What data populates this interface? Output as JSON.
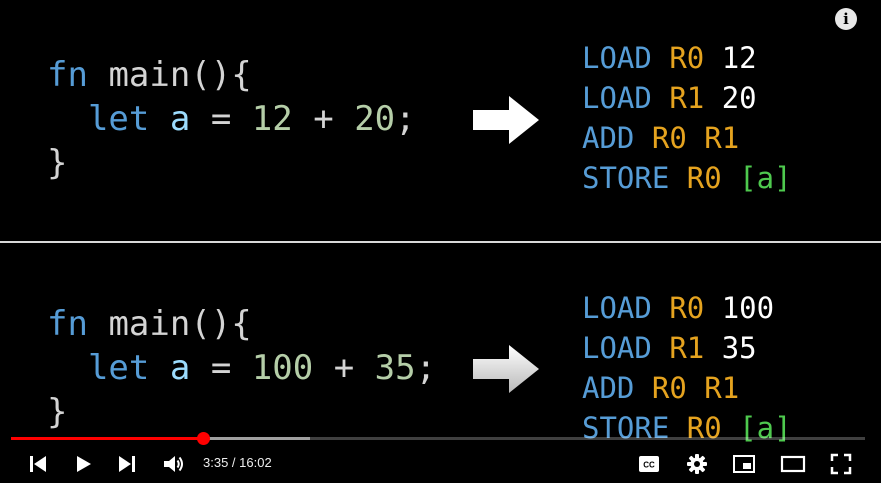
{
  "player": {
    "info_label": "i",
    "time_current": "3:35",
    "time_separator": " / ",
    "time_total": "16:02",
    "progress_played_fraction": 0.2256,
    "progress_buffered_fraction": 0.3503,
    "colors": {
      "played": "#ff0000",
      "accent": "#ff0000"
    },
    "icons": [
      "previous-icon",
      "play-icon",
      "next-icon",
      "volume-icon",
      "captions-icon",
      "settings-icon",
      "miniplayer-icon",
      "theater-mode-icon",
      "fullscreen-icon"
    ]
  },
  "slide": {
    "top": {
      "code": {
        "fn": "fn",
        "main": "main(){",
        "let": "let",
        "var": "a",
        "eq": "=",
        "num1": "12",
        "plus": "+",
        "num2": "20",
        "semi": ";",
        "close": "}"
      },
      "asm": [
        {
          "op": "LOAD",
          "reg": "R0",
          "arg": "12"
        },
        {
          "op": "LOAD",
          "reg": "R1",
          "arg": "20"
        },
        {
          "op": "ADD",
          "reg": "R0",
          "reg2": "R1"
        },
        {
          "op": "STORE",
          "reg": "R0",
          "mem": "[a]"
        }
      ]
    },
    "bottom": {
      "code": {
        "fn": "fn",
        "main": "main(){",
        "let": "let",
        "var": "a",
        "eq": "=",
        "num1": "100",
        "plus": "+",
        "num2": "35",
        "semi": ";",
        "close": "}"
      },
      "asm": [
        {
          "op": "LOAD",
          "reg": "R0",
          "arg": "100"
        },
        {
          "op": "LOAD",
          "reg": "R1",
          "arg": "35"
        },
        {
          "op": "ADD",
          "reg": "R0",
          "reg2": "R1"
        },
        {
          "op": "STORE",
          "reg": "R0",
          "mem": "[a]"
        }
      ]
    }
  }
}
